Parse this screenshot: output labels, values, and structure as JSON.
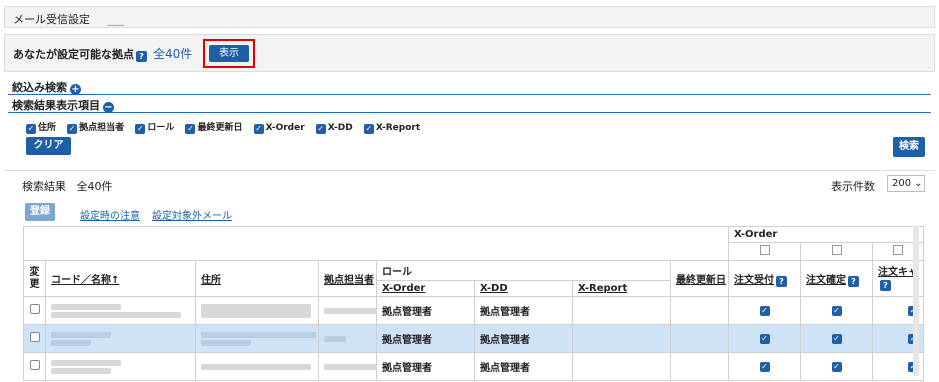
{
  "mail_settings": {
    "title": "メール受信設定",
    "dots": "___"
  },
  "bases": {
    "label": "あなたが設定可能な拠点",
    "total": "全40件",
    "show_label": "表示"
  },
  "filter": {
    "label": "絞込み検索"
  },
  "columns_section": {
    "label": "検索結果表示項目",
    "options": [
      "住所",
      "拠点担当者",
      "ロール",
      "最終更新日",
      "X-Order",
      "X-DD",
      "X-Report"
    ]
  },
  "buttons": {
    "clear": "クリア",
    "search": "検索",
    "register": "登録"
  },
  "results": {
    "label": "検索結果",
    "total": "全40件",
    "display_count_label": "表示件数",
    "display_count_value": "200"
  },
  "links": {
    "caution": "設定時の注意",
    "exclude_mail": "設定対象外メール"
  },
  "table": {
    "group_header": "X-Order",
    "col_change": "変更",
    "col_code": "コード／名称↑",
    "col_address": "住所",
    "col_owner": "拠点担当者",
    "col_role": "ロール",
    "col_role_xorder": "X-Order",
    "col_role_xdd": "X-DD",
    "col_role_xreport": "X-Report",
    "col_updated": "最終更新日",
    "col_order_accept": "注文受付",
    "col_order_confirm": "注文確定",
    "col_order_cancel": "注文キャ",
    "rows": [
      {
        "role_xorder": "拠点管理者",
        "role_xdd": "拠点管理者"
      },
      {
        "role_xorder": "拠点管理者",
        "role_xdd": "拠点管理者"
      },
      {
        "role_xorder": "拠点管理者",
        "role_xdd": "拠点管理者"
      }
    ]
  }
}
